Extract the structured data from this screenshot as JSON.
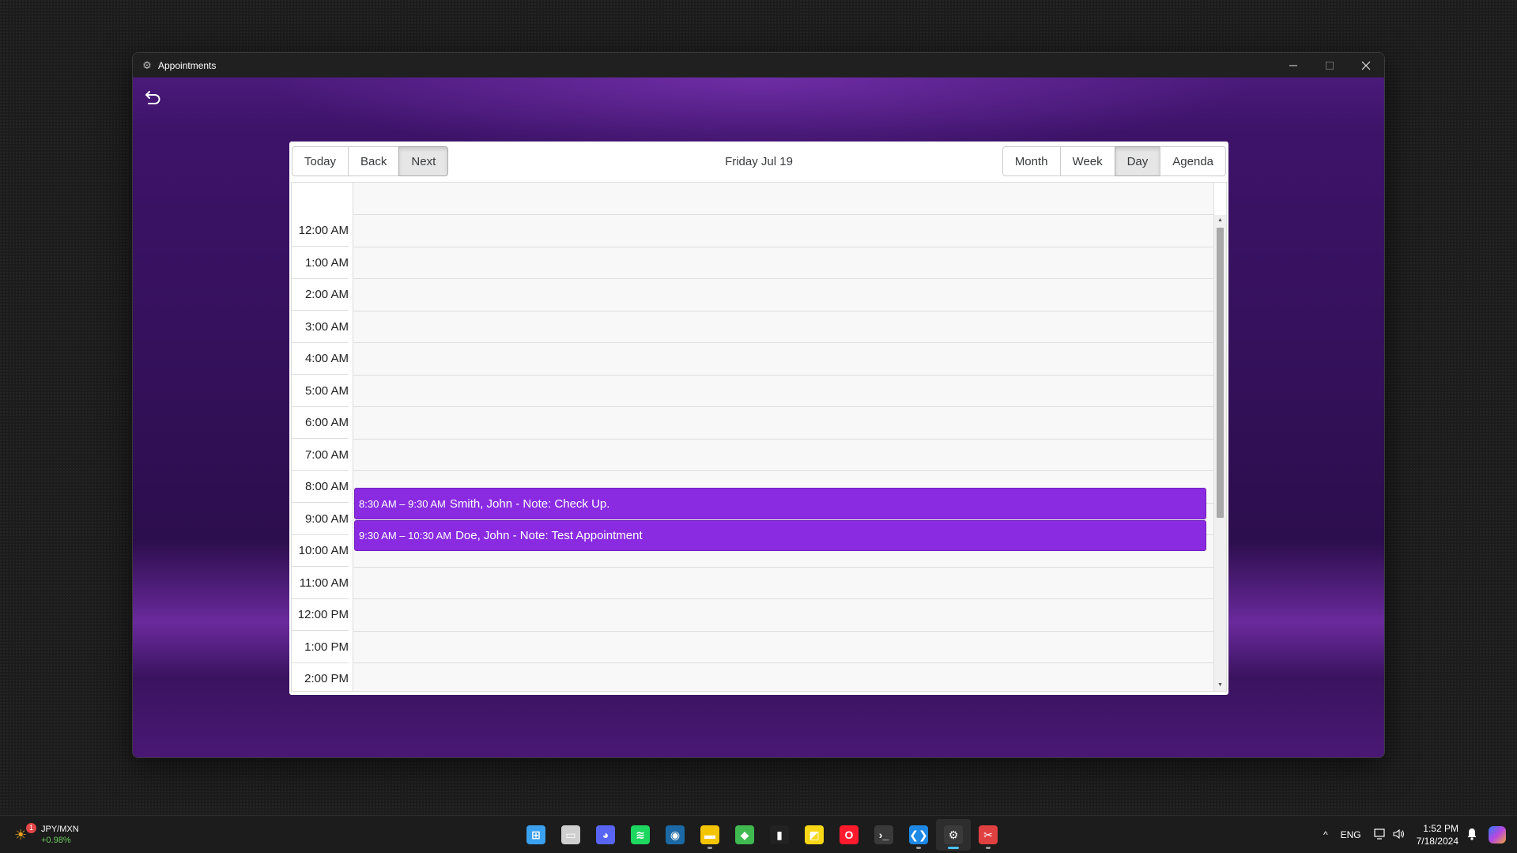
{
  "window": {
    "title": "Appointments",
    "icons": {
      "app": "gear-icon",
      "minimize": "minimize-icon",
      "maximize": "maximize-icon",
      "close": "close-icon"
    }
  },
  "app": {
    "back_icon": "undo-arrow-icon"
  },
  "calendar": {
    "nav_buttons": [
      "Today",
      "Back",
      "Next"
    ],
    "active_nav": "Next",
    "label": "Friday Jul 19",
    "view_buttons": [
      "Month",
      "Week",
      "Day",
      "Agenda"
    ],
    "active_view": "Day",
    "time_slots": [
      "12:00 AM",
      "1:00 AM",
      "2:00 AM",
      "3:00 AM",
      "4:00 AM",
      "5:00 AM",
      "6:00 AM",
      "7:00 AM",
      "8:00 AM",
      "9:00 AM",
      "10:00 AM",
      "11:00 AM",
      "12:00 PM",
      "1:00 PM",
      "2:00 PM"
    ],
    "events": [
      {
        "time": "8:30 AM – 9:30 AM",
        "title": "Smith, John - Note: Check Up.",
        "start_hour": 8.5,
        "end_hour": 9.5
      },
      {
        "time": "9:30 AM – 10:30 AM",
        "title": "Doe, John - Note: Test Appointment",
        "start_hour": 9.5,
        "end_hour": 10.5
      }
    ],
    "event_color": "#8a2be2"
  },
  "taskbar": {
    "widget": {
      "title": "JPY/MXN",
      "change": "+0.98%",
      "badge": "1",
      "icon": "currency-widget-icon"
    },
    "apps": [
      {
        "name": "start-icon",
        "color": "#3aa0f0",
        "glyph": "⊞",
        "active": false,
        "running": false
      },
      {
        "name": "task-view-icon",
        "color": "#cfcfcf",
        "glyph": "▭",
        "active": false,
        "running": false
      },
      {
        "name": "discord-icon",
        "color": "#5865f2",
        "glyph": "◕",
        "active": false,
        "running": false
      },
      {
        "name": "spotify-icon",
        "color": "#1ed760",
        "glyph": "≋",
        "active": false,
        "running": false
      },
      {
        "name": "steam-icon",
        "color": "#1b6aa5",
        "glyph": "◉",
        "active": false,
        "running": false
      },
      {
        "name": "file-explorer-icon",
        "color": "#f5c400",
        "glyph": "▬",
        "active": false,
        "running": true
      },
      {
        "name": "git-client-icon",
        "color": "#3fb950",
        "glyph": "◆",
        "active": false,
        "running": false
      },
      {
        "name": "audio-meter-icon",
        "color": "#222222",
        "glyph": "▮",
        "active": false,
        "running": false
      },
      {
        "name": "sticky-notes-icon",
        "color": "#f7d716",
        "glyph": "◩",
        "active": false,
        "running": false
      },
      {
        "name": "opera-icon",
        "color": "#ff1b2d",
        "glyph": "O",
        "active": false,
        "running": false
      },
      {
        "name": "terminal-icon",
        "color": "#3a3a3a",
        "glyph": "›_",
        "active": false,
        "running": false
      },
      {
        "name": "vscode-icon",
        "color": "#1e88e5",
        "glyph": "❮❯",
        "active": false,
        "running": true
      },
      {
        "name": "appointments-app-icon",
        "color": "#3a3a3a",
        "glyph": "⚙",
        "active": true,
        "running": true
      },
      {
        "name": "snipping-tool-icon",
        "color": "#e04040",
        "glyph": "✂",
        "active": false,
        "running": true
      }
    ],
    "tray": {
      "chevron": "^",
      "language": "ENG",
      "time": "1:52 PM",
      "date": "7/18/2024",
      "icons": [
        "network-icon",
        "volume-icon",
        "bell-icon",
        "copilot-icon"
      ]
    }
  }
}
